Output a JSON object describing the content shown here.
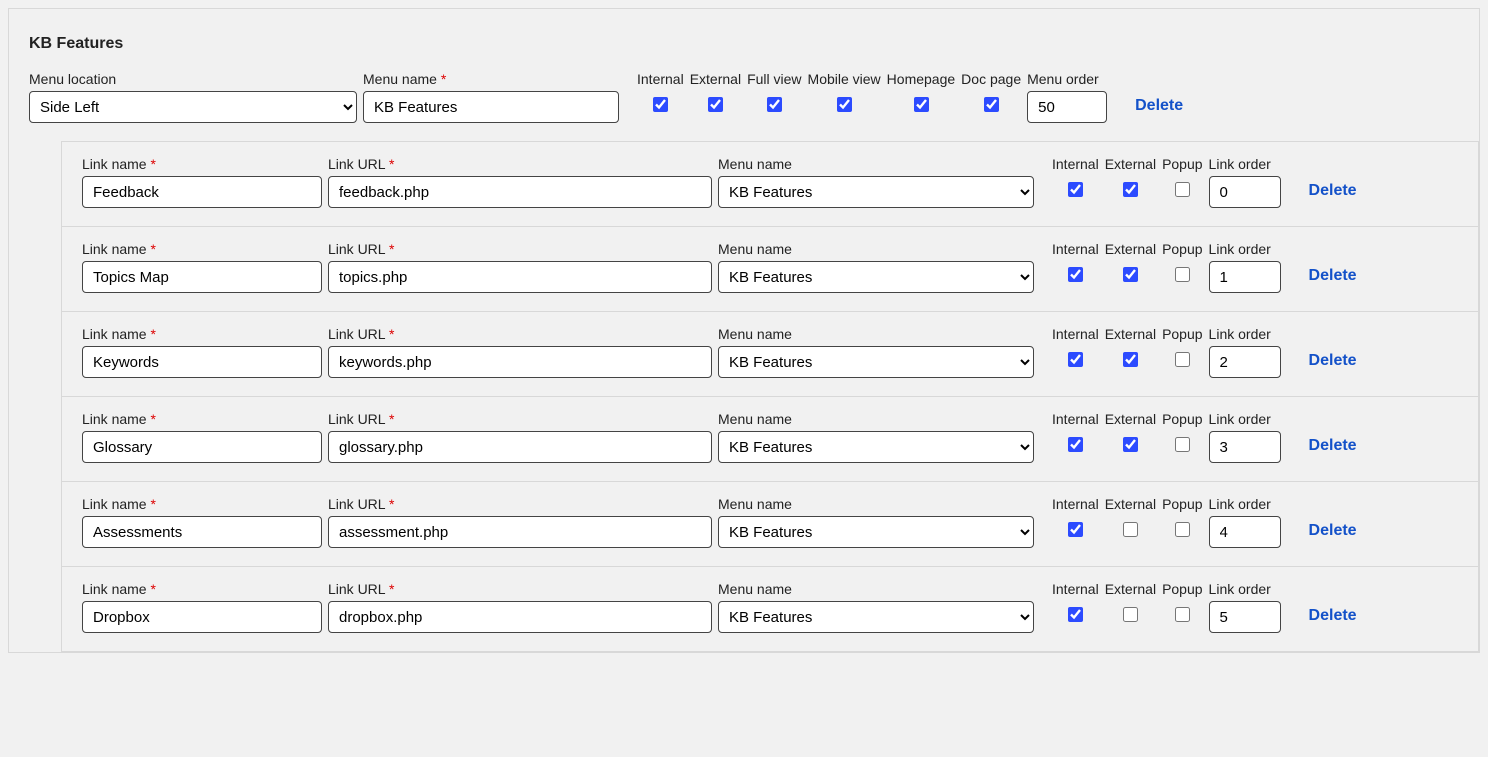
{
  "panel": {
    "title": "KB Features"
  },
  "labels": {
    "menu_location": "Menu location",
    "menu_name": "Menu name",
    "internal": "Internal",
    "external": "External",
    "full_view": "Full view",
    "mobile_view": "Mobile view",
    "homepage": "Homepage",
    "doc_page": "Doc page",
    "menu_order": "Menu order",
    "link_name": "Link name",
    "link_url": "Link URL",
    "popup": "Popup",
    "link_order": "Link order",
    "delete": "Delete",
    "required_mark": "*"
  },
  "menu": {
    "location_value": "Side Left",
    "name_value": "KB Features",
    "internal": true,
    "external": true,
    "full_view": true,
    "mobile_view": true,
    "homepage": true,
    "doc_page": true,
    "order": "50"
  },
  "links": [
    {
      "name": "Feedback",
      "url": "feedback.php",
      "menu": "KB Features",
      "internal": true,
      "external": true,
      "popup": false,
      "order": "0"
    },
    {
      "name": "Topics Map",
      "url": "topics.php",
      "menu": "KB Features",
      "internal": true,
      "external": true,
      "popup": false,
      "order": "1"
    },
    {
      "name": "Keywords",
      "url": "keywords.php",
      "menu": "KB Features",
      "internal": true,
      "external": true,
      "popup": false,
      "order": "2"
    },
    {
      "name": "Glossary",
      "url": "glossary.php",
      "menu": "KB Features",
      "internal": true,
      "external": true,
      "popup": false,
      "order": "3"
    },
    {
      "name": "Assessments",
      "url": "assessment.php",
      "menu": "KB Features",
      "internal": true,
      "external": false,
      "popup": false,
      "order": "4"
    },
    {
      "name": "Dropbox",
      "url": "dropbox.php",
      "menu": "KB Features",
      "internal": true,
      "external": false,
      "popup": false,
      "order": "5"
    }
  ]
}
